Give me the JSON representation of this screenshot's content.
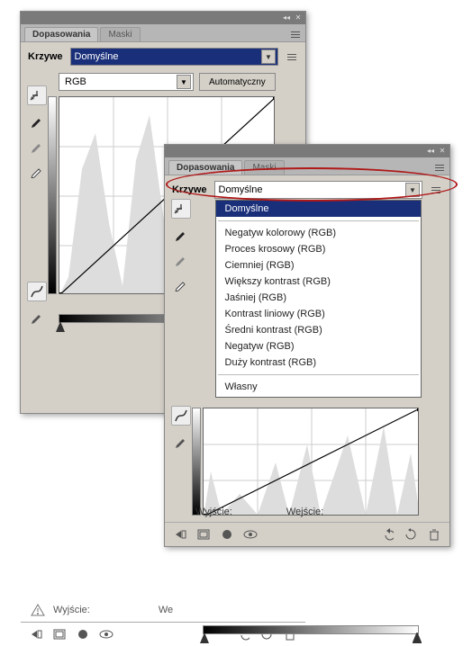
{
  "panel": {
    "tabs": {
      "adjustments": "Dopasowania",
      "masks": "Maski"
    },
    "preset_label": "Krzywe",
    "preset_value": "Domyślne",
    "channel_value": "RGB",
    "auto_label": "Automatyczny",
    "output_label": "Wyjście:",
    "input_label": "Wejście:",
    "output_short": "Wyj",
    "input_short": "We"
  },
  "dropdown": {
    "items": [
      "Domyślne",
      "Negatyw kolorowy (RGB)",
      "Proces krosowy (RGB)",
      "Ciemniej (RGB)",
      "Większy kontrast (RGB)",
      "Jaśniej (RGB)",
      "Kontrast liniowy (RGB)",
      "Średni kontrast (RGB)",
      "Negatyw (RGB)",
      "Duży kontrast (RGB)"
    ],
    "custom": "Własny"
  },
  "icons": {
    "collapse": "◂◂",
    "close": "✕",
    "menu": "≡",
    "arrow": "▼"
  }
}
